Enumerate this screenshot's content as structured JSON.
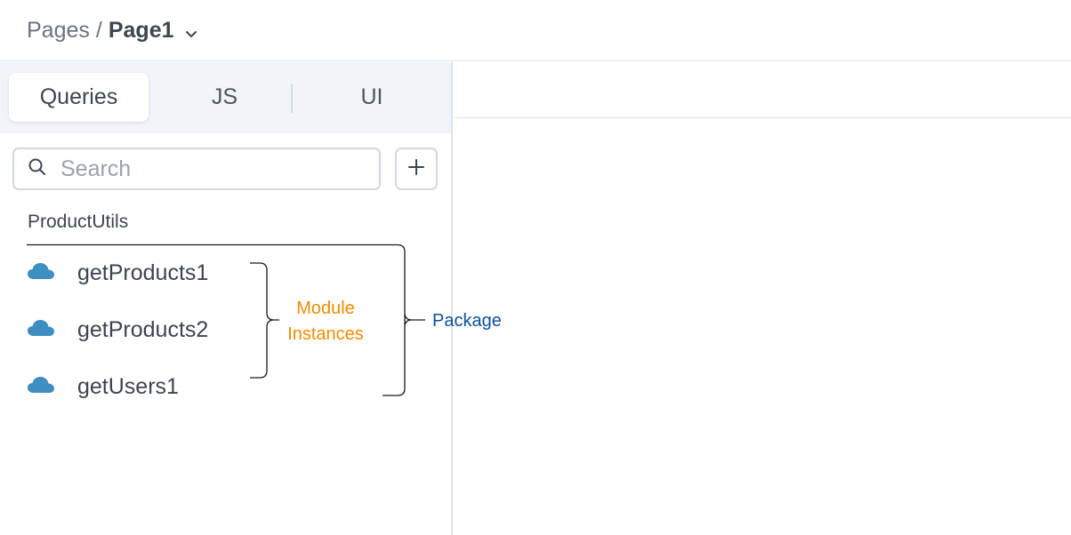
{
  "breadcrumb": {
    "root": "Pages",
    "separator": "/",
    "current": "Page1"
  },
  "tabs": [
    {
      "label": "Queries",
      "active": true
    },
    {
      "label": "JS",
      "active": false
    },
    {
      "label": "UI",
      "active": false
    }
  ],
  "search": {
    "placeholder": "Search",
    "value": ""
  },
  "group": {
    "label": "ProductUtils",
    "items": [
      {
        "label": "getProducts1",
        "icon": "cloud-icon"
      },
      {
        "label": "getProducts2",
        "icon": "cloud-icon"
      },
      {
        "label": "getUsers1",
        "icon": "cloud-icon"
      }
    ]
  },
  "annotations": {
    "module_line1": "Module",
    "module_line2": "Instances",
    "package": "Package"
  },
  "colors": {
    "cloud_icon": "#3d8ec1",
    "module_annotation": "#f08c00",
    "package_annotation": "#0d4f99"
  }
}
